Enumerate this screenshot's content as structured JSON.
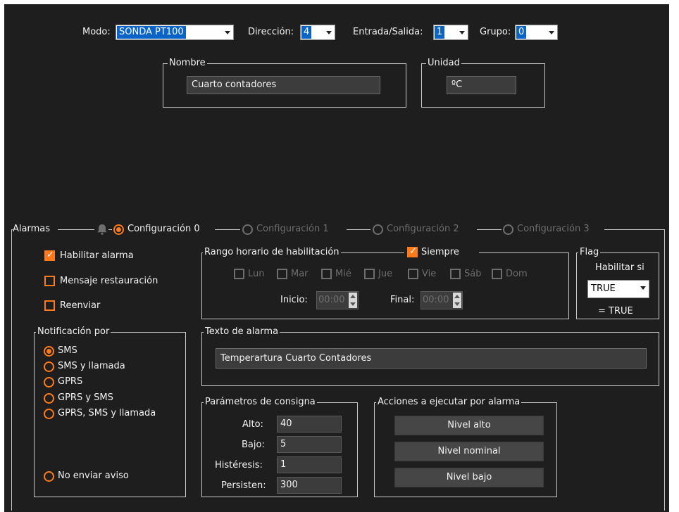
{
  "top": {
    "modo_label": "Modo:",
    "modo_value": "SONDA PT100",
    "direccion_label": "Dirección:",
    "direccion_value": "4",
    "es_label": "Entrada/Salida:",
    "es_value": "1",
    "grupo_label": "Grupo:",
    "grupo_value": "0"
  },
  "nombre": {
    "legend": "Nombre",
    "value": "Cuarto contadores"
  },
  "unidad": {
    "legend": "Unidad",
    "value": "ºC"
  },
  "alarmas": {
    "legend": "Alarmas",
    "bell_icon": "bell-icon",
    "configs": [
      {
        "label": "Configuración 0",
        "selected": true
      },
      {
        "label": "Configuración 1",
        "selected": false
      },
      {
        "label": "Configuración 2",
        "selected": false
      },
      {
        "label": "Configuración 3",
        "selected": false
      }
    ],
    "habilitar_alarma": "Habilitar alarma",
    "mensaje_restauracion": "Mensaje restauración",
    "reenviar": "Reenviar"
  },
  "rango": {
    "legend": "Rango horario de habilitación",
    "siempre": "Siempre",
    "days": [
      "Lun",
      "Mar",
      "Mié",
      "Jue",
      "Vie",
      "Sáb",
      "Dom"
    ],
    "inicio_label": "Inicio:",
    "inicio_value": "00:00",
    "final_label": "Final:",
    "final_value": "00:00"
  },
  "flag": {
    "legend": "Flag",
    "habilitar_si": "Habilitar si",
    "value": "TRUE",
    "result": "= TRUE"
  },
  "notificacion": {
    "legend": "Notificación por",
    "options": [
      "SMS",
      "SMS y llamada",
      "GPRS",
      "GPRS y SMS",
      "GPRS, SMS y llamada"
    ],
    "no_enviar": "No enviar aviso"
  },
  "texto": {
    "legend": "Texto de alarma",
    "value": "Temperartura Cuarto Contadores"
  },
  "consigna": {
    "legend": "Parámetros de consigna",
    "alto_label": "Alto:",
    "alto_value": "40",
    "bajo_label": "Bajo:",
    "bajo_value": "5",
    "histeresis_label": "Histéresis:",
    "histeresis_value": "1",
    "persisten_label": "Persisten:",
    "persisten_value": "300"
  },
  "acciones": {
    "legend": "Acciones a ejecutar por alarma",
    "nivel_alto": "Nivel alto",
    "nivel_nominal": "Nivel nominal",
    "nivel_bajo": "Nivel bajo"
  },
  "colors": {
    "accent": "#ff7a1a",
    "background": "#1e1e1e",
    "selection": "#0a64c8"
  }
}
